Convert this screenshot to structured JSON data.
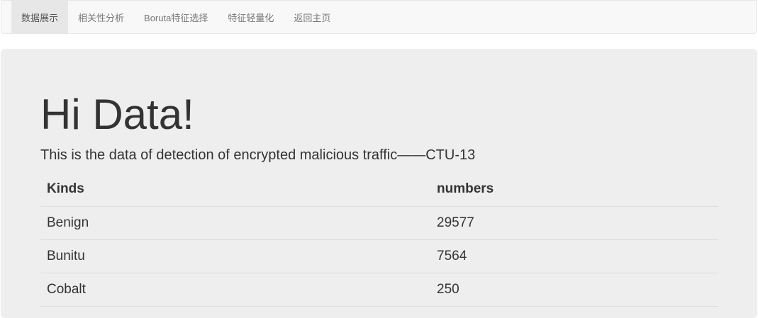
{
  "nav": {
    "items": [
      {
        "label": "数据展示",
        "active": true
      },
      {
        "label": "相关性分析",
        "active": false
      },
      {
        "label": "Boruta特征选择",
        "active": false
      },
      {
        "label": "特征轻量化",
        "active": false
      },
      {
        "label": "返回主页",
        "active": false
      }
    ]
  },
  "hero": {
    "title": "Hi Data!",
    "subtitle": "This is the data of detection of encrypted malicious traffic——CTU-13"
  },
  "table": {
    "headers": [
      "Kinds",
      "numbers"
    ],
    "rows": [
      [
        "Benign",
        "29577"
      ],
      [
        "Bunitu",
        "7564"
      ],
      [
        "Cobalt",
        "250"
      ]
    ]
  },
  "colors": {
    "navbar_bg": "#f8f8f8",
    "nav_active_bg": "#e7e7e7",
    "jumbotron_bg": "#eeeeee",
    "text": "#333333"
  }
}
